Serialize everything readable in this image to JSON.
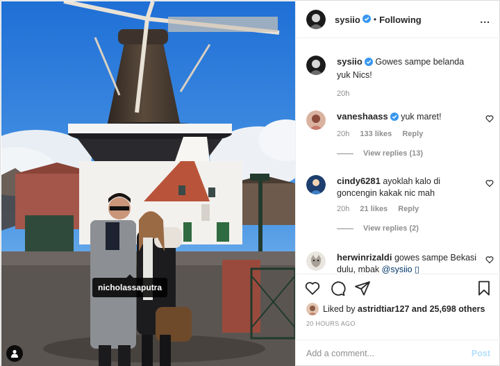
{
  "post": {
    "username": "sysiio",
    "follow_status": "Following",
    "dot": "•",
    "more_label": "...",
    "photo_tag": "nicholassaputra",
    "caption": {
      "username": "sysiio",
      "text": "Gowes sampe belanda yuk Nics!",
      "time": "20h"
    }
  },
  "comments": [
    {
      "username": "vaneshaass",
      "text": "yuk maret!",
      "time": "20h",
      "likes": "133 likes",
      "reply_label": "Reply",
      "view_replies": "View replies (13)"
    },
    {
      "username": "cindy6281",
      "text": "ayoklah kalo di goncengin kakak nic mah",
      "time": "20h",
      "likes": "21 likes",
      "reply_label": "Reply",
      "view_replies": "View replies (2)"
    },
    {
      "username": "herwinrizaldi",
      "text": "gowes sampe Bekasi dulu, mbak",
      "mention": "@sysiio",
      "emoji": "▯"
    }
  ],
  "liked_by": {
    "prefix": "Liked by",
    "user": "astridtiar127",
    "suffix": "and 25,698 others"
  },
  "timestamp": "20 HOURS AGO",
  "add_comment": {
    "placeholder": "Add a comment...",
    "post_label": "Post"
  },
  "colors": {
    "verified": "#3897f0",
    "text": "#262626",
    "muted": "#8e8e8e",
    "post_disabled": "#b2dffc",
    "link": "#00376b"
  }
}
